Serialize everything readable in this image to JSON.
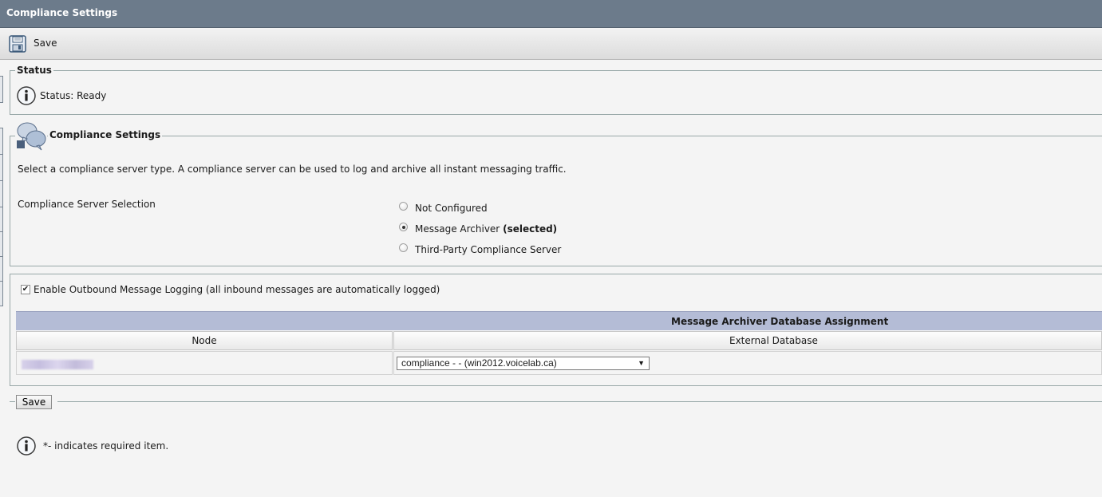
{
  "window": {
    "title": "Compliance Settings"
  },
  "toolbar": {
    "save_label": "Save"
  },
  "status_section": {
    "legend": "Status",
    "text": "Status: Ready"
  },
  "compliance_section": {
    "legend": "Compliance Settings",
    "description": "Select a compliance server type. A compliance server can be used to log and archive all instant messaging traffic.",
    "selection_label": "Compliance Server Selection",
    "options": [
      {
        "label": "Not Configured",
        "suffix": "",
        "selected": false
      },
      {
        "label": "Message Archiver",
        "suffix": "(selected)",
        "selected": true
      },
      {
        "label": "Third-Party Compliance Server",
        "suffix": "",
        "selected": false
      }
    ]
  },
  "logging": {
    "checkbox_label": "Enable Outbound Message Logging (all inbound messages are automatically logged)",
    "checked": true
  },
  "table": {
    "title": "Message Archiver Database Assignment",
    "columns": [
      "Node",
      "External Database"
    ],
    "rows": [
      {
        "node": "",
        "database": "compliance - - (win2012.voicelab.ca)"
      }
    ]
  },
  "footer": {
    "save_label": "Save",
    "note": "*- indicates required item."
  },
  "icons": {
    "save": "floppy-disk-icon",
    "info": "info-icon",
    "settings": "chat-bubbles-icon"
  }
}
